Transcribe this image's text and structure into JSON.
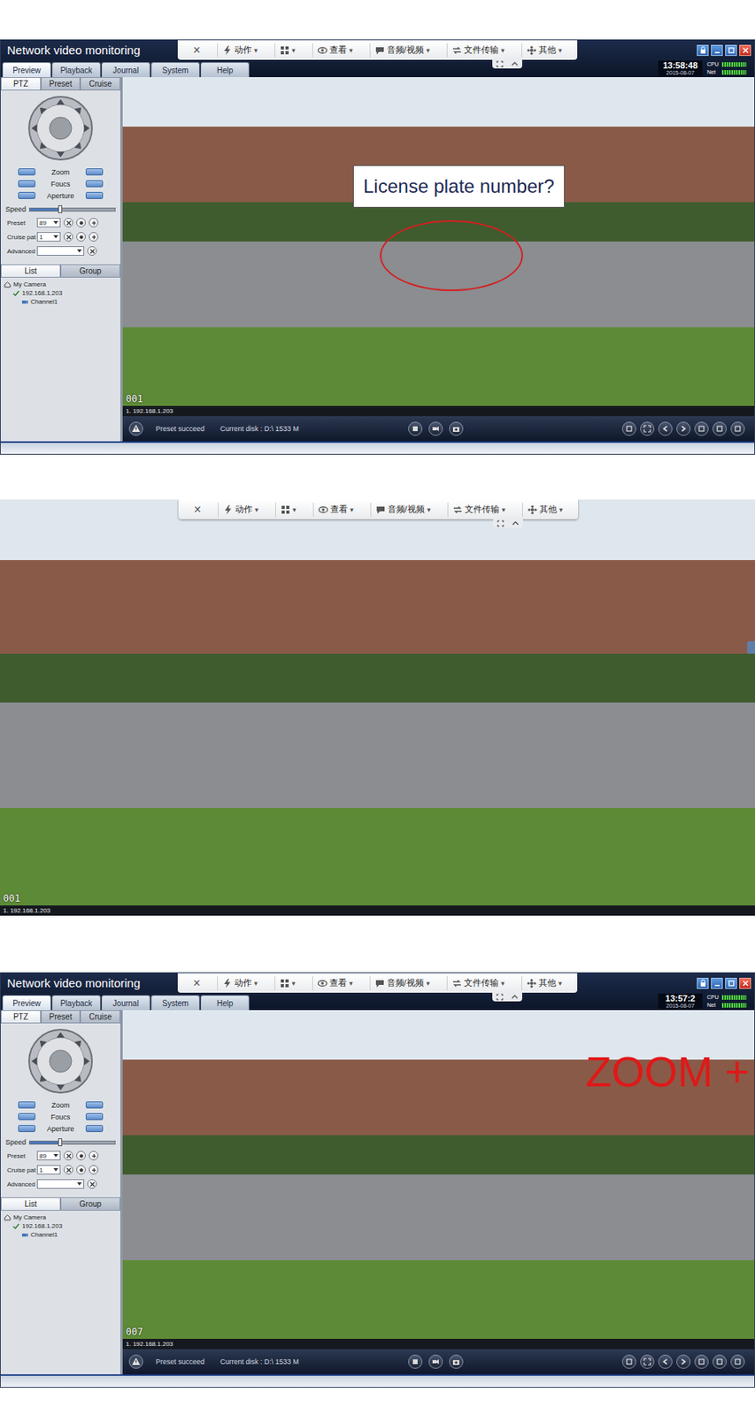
{
  "window": {
    "title": "Network video monitoring"
  },
  "toolbar": {
    "close": "×",
    "items": [
      {
        "kind": "action",
        "label": "动作",
        "arrow": "▾"
      },
      {
        "kind": "layout",
        "arrow": "▾"
      },
      {
        "kind": "view",
        "label": "查看",
        "arrow": "▾"
      },
      {
        "kind": "av",
        "label": "音频/视频",
        "arrow": "▾"
      },
      {
        "kind": "file",
        "label": "文件传输",
        "arrow": "▾"
      },
      {
        "kind": "other",
        "label": "其他",
        "arrow": "▾"
      }
    ]
  },
  "menu": [
    {
      "label": "Preview",
      "selected": true
    },
    {
      "label": "Playback",
      "selected": false
    },
    {
      "label": "Journal",
      "selected": false
    },
    {
      "label": "System",
      "selected": false
    },
    {
      "label": "Help",
      "selected": false
    }
  ],
  "meters": [
    {
      "label": "CPU",
      "level": 0.9
    },
    {
      "label": "Net",
      "level": 0.9
    }
  ],
  "sidebar": {
    "tabs": [
      {
        "label": "PTZ",
        "selected": true
      },
      {
        "label": "Preset",
        "selected": false
      },
      {
        "label": "Cruise",
        "selected": false
      }
    ],
    "lens": [
      "Zoom",
      "Foucs",
      "Aperture"
    ],
    "speed": {
      "label": "Speed",
      "level": 0.35
    },
    "preset": {
      "label": "Preset",
      "value": "89"
    },
    "cruise": {
      "label": "Cruise pat",
      "value": "1"
    },
    "advanced": {
      "label": "Advanced"
    },
    "list_tabs": [
      {
        "label": "List",
        "selected": true
      },
      {
        "label": "Group",
        "selected": false
      }
    ],
    "tree": [
      {
        "label": "My Camera",
        "depth": 0,
        "kind": "home"
      },
      {
        "label": "192.168.1.203",
        "depth": 1,
        "kind": "device"
      },
      {
        "label": "Channel1",
        "depth": 2,
        "kind": "channel"
      }
    ]
  },
  "status": {
    "message": "Preset succeed",
    "disk": "Current disk : D:\\ 1533 M"
  },
  "panels": [
    {
      "kind": "full",
      "clock": {
        "time": "13:58:48",
        "date": "2015-08-07"
      },
      "video": {
        "channel": "001",
        "source": "1. 192.168.1.203",
        "callout": "License plate number?"
      }
    },
    {
      "kind": "video",
      "video": {
        "channel": "001",
        "source": "1. 192.168.1.203"
      }
    },
    {
      "kind": "full",
      "clock": {
        "time": "13:57:2",
        "date": "2015-08-07"
      },
      "video": {
        "channel": "007",
        "source": "1. 192.168.1.203",
        "zoom": "ZOOM +"
      }
    }
  ]
}
